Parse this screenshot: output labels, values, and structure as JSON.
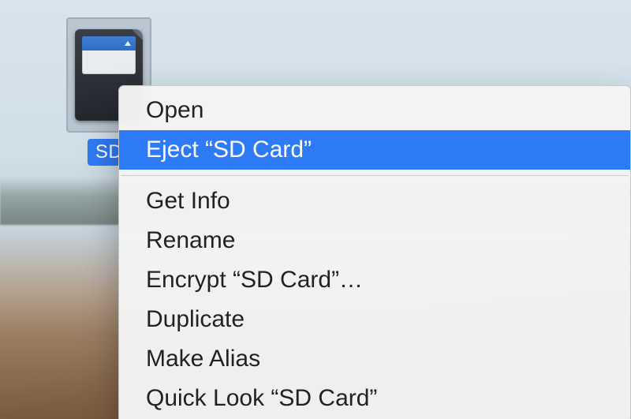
{
  "desktop": {
    "icon_label": "SD"
  },
  "context_menu": {
    "open": "Open",
    "eject": "Eject “SD Card”",
    "get_info": "Get Info",
    "rename": "Rename",
    "encrypt": "Encrypt “SD Card”…",
    "duplicate": "Duplicate",
    "make_alias": "Make Alias",
    "quick_look": "Quick Look “SD Card”"
  },
  "colors": {
    "highlight": "#2d7bf6"
  }
}
